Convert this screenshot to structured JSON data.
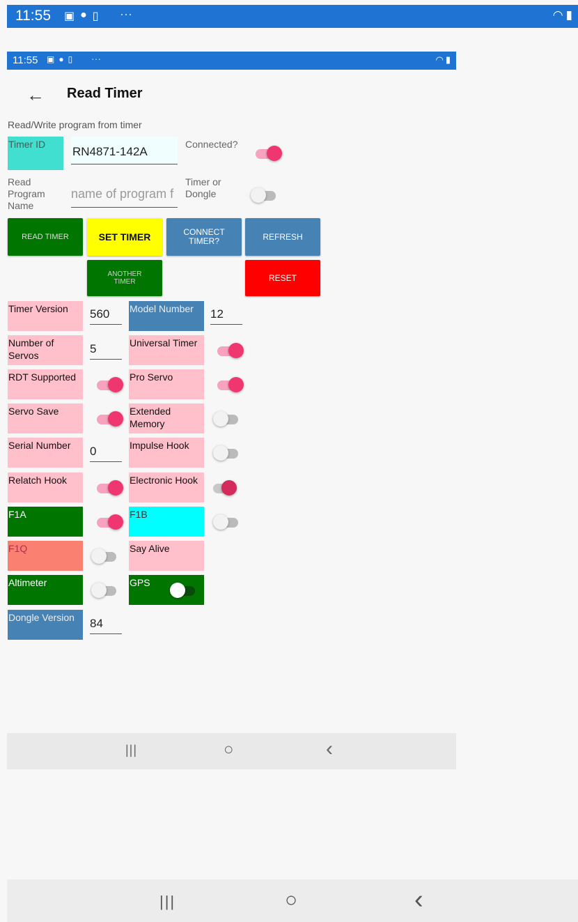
{
  "outer_status": {
    "time": "11:55",
    "dots": "···",
    "right_icons": [
      "wifi-icon",
      "battery-icon"
    ]
  },
  "inner_status": {
    "time": "11:55",
    "dots": "···"
  },
  "header": {
    "back_glyph": "←",
    "title": "Read Timer"
  },
  "subtitle": "Read/Write  program from timer",
  "timer_id": {
    "label": "Timer ID",
    "value": "RN4871-142A"
  },
  "connected": {
    "label": "Connected?",
    "on": true
  },
  "program_name": {
    "label_1": "Read",
    "label_2": "Program",
    "label_3": "Name",
    "placeholder": "name of program f"
  },
  "timer_or_dongle": {
    "label_1": "Timer or",
    "label_2": "Dongle",
    "on": false
  },
  "buttons": {
    "read_timer": "READ TIMER",
    "set_timer": "SET TIMER",
    "connect_timer_1": "CONNECT",
    "connect_timer_2": "TIMER?",
    "refresh": "REFRESH",
    "another_timer_1": "ANOTHER",
    "another_timer_2": "TIMER",
    "reset": "RESET"
  },
  "fields": {
    "timer_version": {
      "label": "Timer Version",
      "value": "560"
    },
    "model_number": {
      "label": "Model Number",
      "value": "12"
    },
    "num_servos": {
      "label_1": "Number of",
      "label_2": "Servos",
      "value": "5"
    },
    "universal_timer": {
      "label": "Universal Timer",
      "on": true
    },
    "rdt_supported": {
      "label": "RDT Supported",
      "on": true
    },
    "pro_servo": {
      "label": "Pro Servo",
      "on": true
    },
    "servo_save": {
      "label": "Servo Save",
      "on": true
    },
    "extended_memory": {
      "label_1": "Extended",
      "label_2": "Memory",
      "on": false
    },
    "serial_number": {
      "label": "Serial Number",
      "value": "0"
    },
    "impulse_hook": {
      "label": "Impulse Hook",
      "on": false
    },
    "relatch_hook": {
      "label": "Relatch Hook",
      "on": true
    },
    "electronic_hook": {
      "label": "Electronic Hook",
      "on": true
    },
    "f1a": {
      "label": "F1A",
      "on": true
    },
    "f1b": {
      "label": "F1B",
      "on": false
    },
    "f1q": {
      "label": "F1Q",
      "on": false
    },
    "say_alive": {
      "label": "Say Alive"
    },
    "altimeter": {
      "label": "Altimeter",
      "on": false
    },
    "gps": {
      "label": "GPS",
      "on": false
    },
    "dongle_version": {
      "label": "Dongle Version",
      "value": "84"
    }
  },
  "nav": {
    "recents": "|||",
    "home": "○",
    "back": "‹"
  },
  "colors": {
    "status_blue": "#1f73d2",
    "teal": "#40dfd0",
    "pink": "#ffc0cb",
    "steel_blue": "#4682b4",
    "green": "#007500",
    "yellow": "#ffff00",
    "red": "#ff0000",
    "cyan": "#00ffff",
    "salmon": "#fa8072",
    "switch_on": "#f0366e"
  }
}
